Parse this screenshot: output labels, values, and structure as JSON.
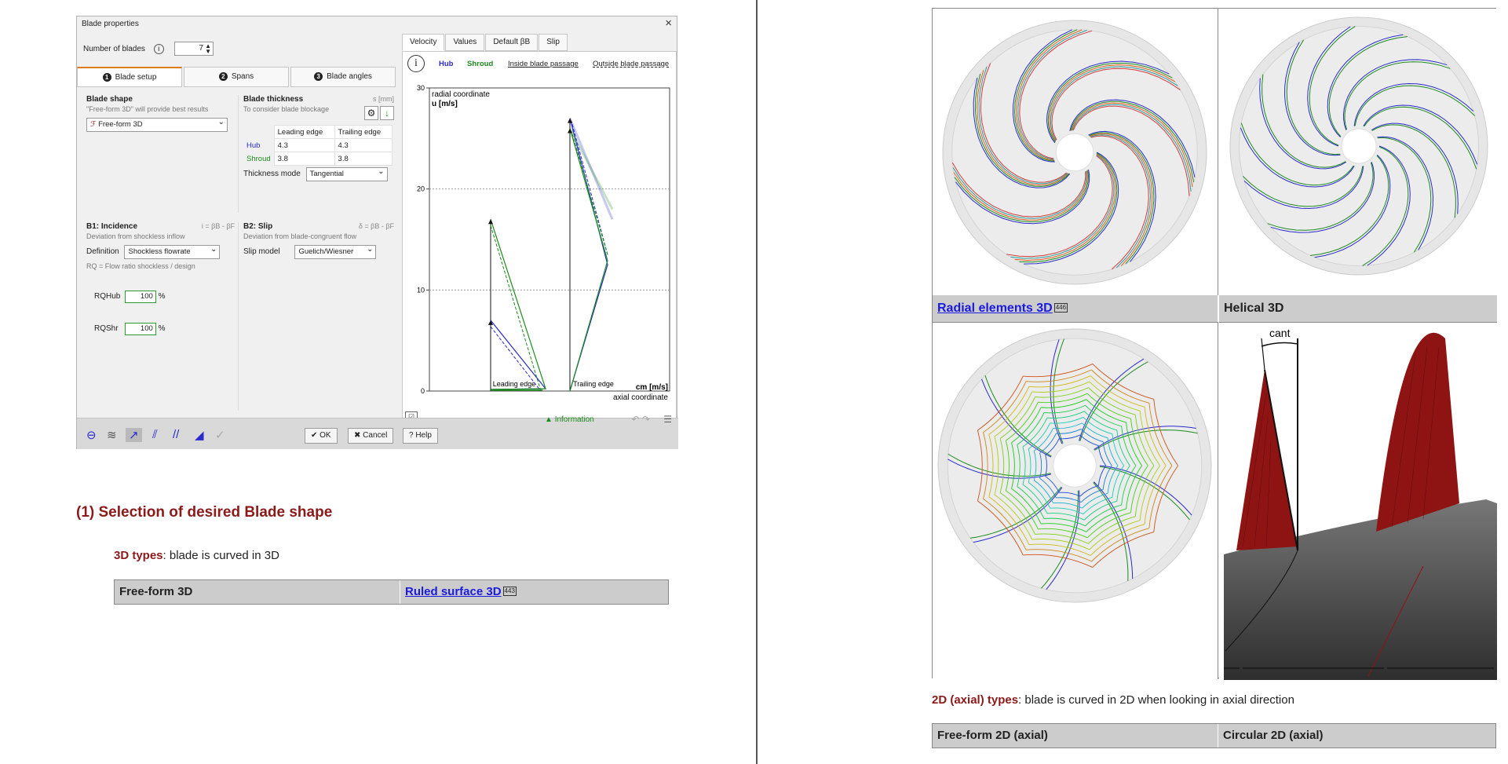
{
  "dialog": {
    "title": "Blade properties",
    "close": "×",
    "number_of_blades_label": "Number of blades",
    "number_of_blades_value": "7",
    "tabs": [
      "Blade setup",
      "Spans",
      "Blade angles"
    ],
    "tab_numbers": [
      "1",
      "2",
      "3"
    ],
    "blade_shape": {
      "title": "Blade shape",
      "note": "\"Free-form 3D\" will provide best results",
      "selected": "Free-form 3D"
    },
    "blade_thickness": {
      "title": "Blade thickness",
      "unit": "s [mm]",
      "note": "To consider blade blockage",
      "col_leading": "Leading edge",
      "col_trailing": "Trailing edge",
      "rows": [
        {
          "label": "Hub",
          "leading": "4.3",
          "trailing": "4.3"
        },
        {
          "label": "Shroud",
          "leading": "3.8",
          "trailing": "3.8"
        }
      ],
      "mode_label": "Thickness mode",
      "mode_value": "Tangential"
    },
    "incidence": {
      "title": "B1: Incidence",
      "formula": "i = βB - βF",
      "note": "Deviation from shockless inflow",
      "definition_label": "Definition",
      "definition_value": "Shockless flowrate",
      "rq_note": "RQ = Flow ratio shockless / design",
      "rqhub_label": "RQHub",
      "rqhub_value": "100",
      "rqshr_label": "RQShr",
      "rqshr_value": "100",
      "percent": "%"
    },
    "slip": {
      "title": "B2: Slip",
      "formula": "δ = βB - βF",
      "note": "Deviation from blade-congruent flow",
      "model_label": "Slip model",
      "model_value": "Guelich/Wiesner"
    },
    "right_tabs": [
      "Velocity",
      "Values",
      "Default βB",
      "Slip"
    ],
    "legend": {
      "hub": "Hub",
      "shroud": "Shroud",
      "inside": "Inside blade passage",
      "outside": "Outside blade passage"
    },
    "info_link": "Information",
    "buttons": {
      "ok": "✔ OK",
      "cancel": "✖ Cancel",
      "help": "? Help"
    }
  },
  "chart_data": {
    "type": "line",
    "title": "",
    "ylabel_top": "radial coordinate",
    "ylabel": "u [m/s]",
    "xlabel": "cm [m/s]",
    "xlabel_bottom": "axial coordinate",
    "ylim": [
      0,
      30
    ],
    "yticks": [
      "0",
      "10",
      "20",
      "30"
    ],
    "x_categories": [
      "Leading edge",
      "Trailing edge"
    ],
    "grid": true,
    "series": [
      {
        "name": "Hub",
        "color": "#2a2acc",
        "leading_u": 7,
        "trailing_u": 27
      },
      {
        "name": "Shroud",
        "color": "#1c8a1c",
        "leading_u": 17,
        "trailing_u": 26
      }
    ]
  },
  "left_section": {
    "heading": "(1) Selection of desired Blade shape",
    "types_label": "3D types",
    "types_text": ": blade is curved in 3D",
    "row": {
      "cell1": "Free-form 3D",
      "cell2": "Ruled surface 3D",
      "cell2_badge": "443"
    }
  },
  "right_section": {
    "captions": [
      {
        "text": "Radial elements 3D",
        "badge": "446"
      },
      {
        "text": "Helical 3D"
      }
    ],
    "cant_label": "cant",
    "types_label": "2D (axial) types",
    "types_text": ": blade is curved in 2D when looking in axial direction",
    "row": {
      "cell1": "Free-form 2D (axial)",
      "cell2": "Circular 2D (axial)"
    }
  }
}
